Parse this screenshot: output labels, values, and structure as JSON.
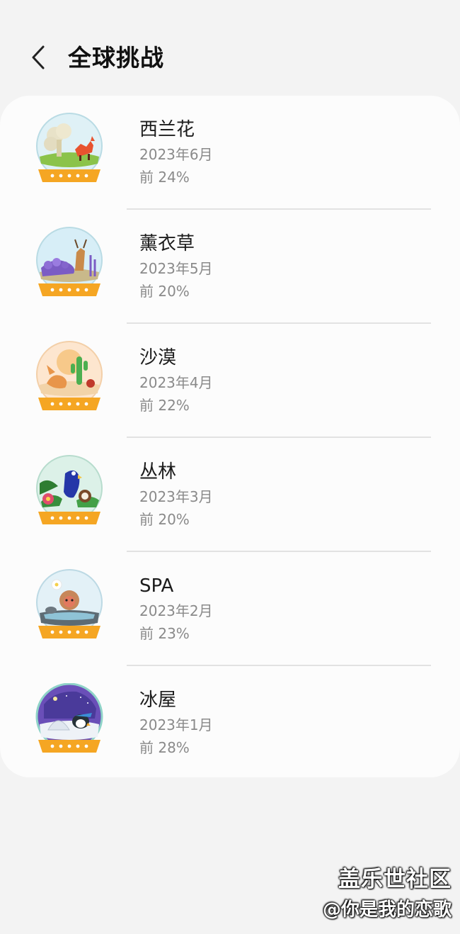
{
  "header": {
    "title": "全球挑战",
    "back_icon": "chevron-left-icon"
  },
  "challenges": [
    {
      "name": "西兰花",
      "date": "2023年6月",
      "rank": "前 24%",
      "badge_icon": "broccoli-fox-globe-icon",
      "theme_color": "#8bc34a"
    },
    {
      "name": "薰衣草",
      "date": "2023年5月",
      "rank": "前 20%",
      "badge_icon": "lavender-deer-globe-icon",
      "theme_color": "#7e57c2"
    },
    {
      "name": "沙漠",
      "date": "2023年4月",
      "rank": "前 22%",
      "badge_icon": "desert-fox-globe-icon",
      "theme_color": "#f4a261"
    },
    {
      "name": "丛林",
      "date": "2023年3月",
      "rank": "前 20%",
      "badge_icon": "jungle-parrot-globe-icon",
      "theme_color": "#2e7d32"
    },
    {
      "name": "SPA",
      "date": "2023年2月",
      "rank": "前 23%",
      "badge_icon": "spa-monkey-globe-icon",
      "theme_color": "#90a4ae"
    },
    {
      "name": "冰屋",
      "date": "2023年1月",
      "rank": "前 28%",
      "badge_icon": "igloo-penguin-globe-icon",
      "theme_color": "#5c6bc0"
    }
  ],
  "watermark": {
    "line1": "盖乐世社区",
    "line2": "@你是我的恋歌"
  },
  "colors": {
    "background": "#f3f3f3",
    "card": "#fcfcfc",
    "badge_ribbon": "#f5a623"
  }
}
